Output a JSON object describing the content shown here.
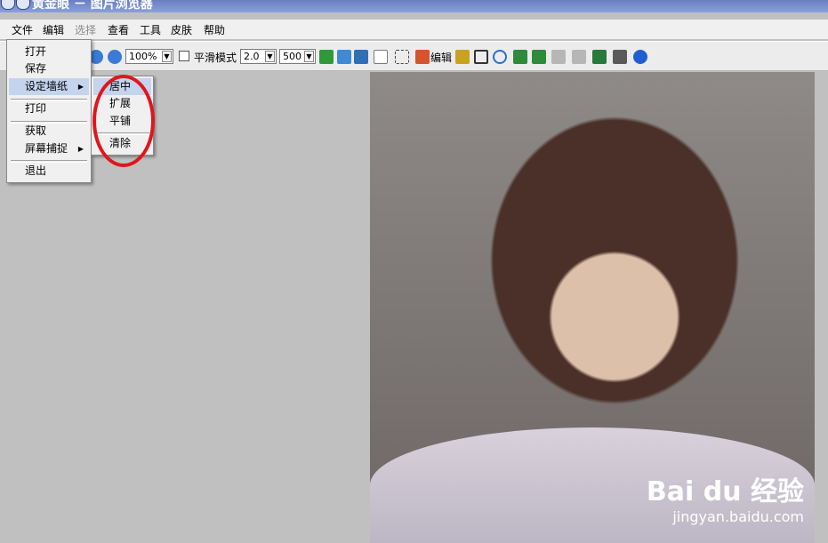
{
  "window": {
    "title": "黄金眼 － 图片浏览器"
  },
  "menubar": {
    "items": [
      "文件",
      "编辑",
      "选择",
      "查看",
      "工具",
      "皮肤",
      "帮助"
    ]
  },
  "toolbar": {
    "zoom_value": "100%",
    "smooth_label": "平滑模式",
    "factor_value": "2.0",
    "size_value": "500",
    "edit_label": "编辑"
  },
  "file_menu": {
    "items": [
      "打开",
      "保存",
      "设定墙纸",
      "打印",
      "获取",
      "屏幕捕捉",
      "退出"
    ]
  },
  "wallpaper_menu": {
    "items": [
      "居中",
      "扩展",
      "平铺",
      "清除"
    ]
  },
  "watermark": {
    "brand": "Bai du 经验",
    "url": "jingyan.baidu.com"
  },
  "colors": {
    "titlebar": "#6b7fc0",
    "menu_highlight": "#c4d4ee",
    "annotation": "#e0161c"
  }
}
